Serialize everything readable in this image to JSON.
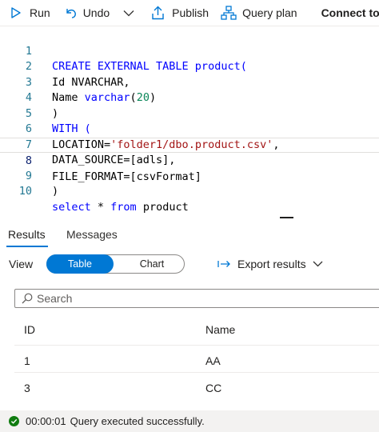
{
  "toolbar": {
    "run_label": "Run",
    "undo_label": "Undo",
    "publish_label": "Publish",
    "query_plan_label": "Query plan",
    "connect_to_label": "Connect to"
  },
  "editor": {
    "lines": [
      {
        "number": "1",
        "text": "CREATE EXTERNAL TABLE product("
      },
      {
        "number": "2",
        "text": "Id NVARCHAR,"
      },
      {
        "number": "3",
        "text": "Name varchar(20)"
      },
      {
        "number": "4",
        "text": ")"
      },
      {
        "number": "5",
        "text": "WITH ("
      },
      {
        "number": "6",
        "text": "LOCATION='folder1/dbo.product.csv',"
      },
      {
        "number": "7",
        "text": "DATA_SOURCE=[adls],"
      },
      {
        "number": "8",
        "text": "FILE_FORMAT=[csvFormat]"
      },
      {
        "number": "9",
        "text": ")"
      },
      {
        "number": "10",
        "text": "select * from product"
      }
    ],
    "current_line": 8
  },
  "results": {
    "tabs": [
      "Results",
      "Messages"
    ],
    "active_tab": "Results",
    "view_label": "View",
    "view_options": [
      "Table",
      "Chart"
    ],
    "selected_view": "Table",
    "export_label": "Export results",
    "search_placeholder": "Search",
    "columns": [
      "ID",
      "Name"
    ],
    "rows": [
      [
        "1",
        "AA"
      ],
      [
        "3",
        "CC"
      ]
    ]
  },
  "status": {
    "elapsed": "00:00:01",
    "message": "Query executed successfully."
  },
  "colors": {
    "accent": "#0078d4",
    "success": "#107c10",
    "keyword": "#0000ff",
    "string": "#a31515",
    "number": "#098658",
    "line_number": "#237893"
  }
}
